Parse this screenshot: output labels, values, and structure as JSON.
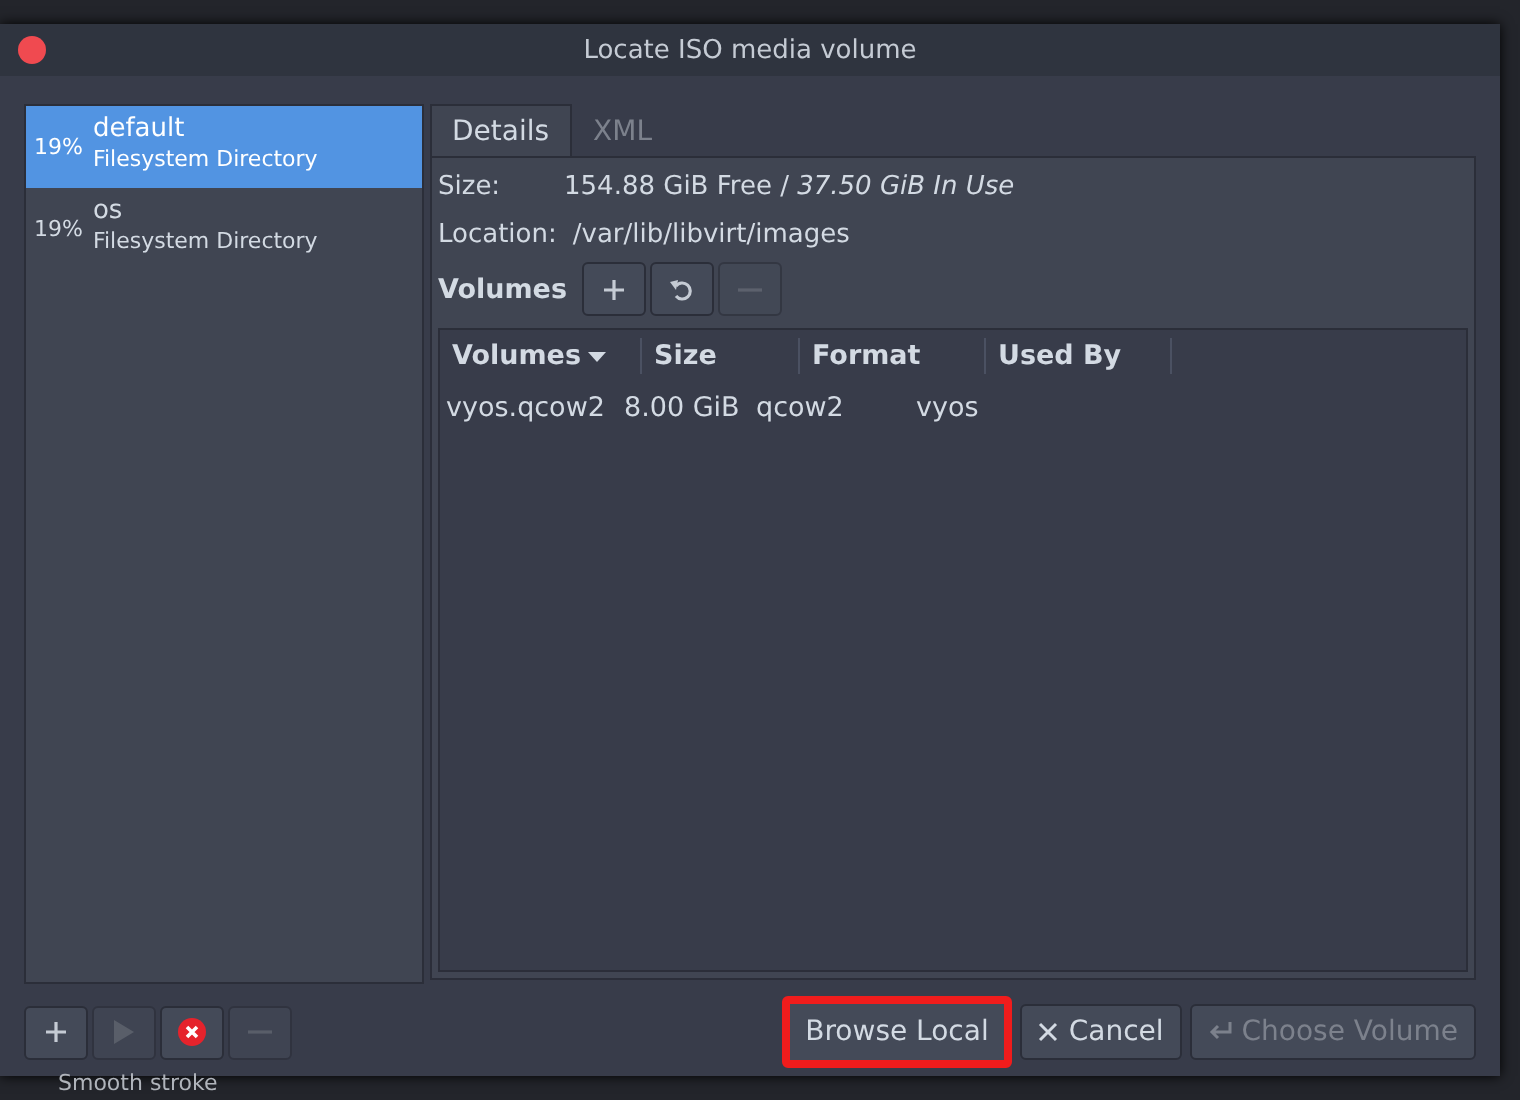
{
  "window": {
    "title": "Locate ISO media volume"
  },
  "pools": [
    {
      "usage": "19%",
      "name": "default",
      "type": "Filesystem Directory",
      "selected": true
    },
    {
      "usage": "19%",
      "name": "os",
      "type": "Filesystem Directory",
      "selected": false
    }
  ],
  "pool_buttons": [
    {
      "kind": "add",
      "disabled": false
    },
    {
      "kind": "start",
      "disabled": true
    },
    {
      "kind": "delete",
      "disabled": false
    },
    {
      "kind": "remove",
      "disabled": true
    }
  ],
  "tabs": [
    {
      "label": "Details",
      "selected": true
    },
    {
      "label": "XML",
      "selected": false
    }
  ],
  "details": {
    "size_label": "Size:",
    "size_value": "154.88 GiB Free / *37.50 GiB In Use*",
    "location_label": "Location:",
    "location_value": "/var/lib/libvirt/images"
  },
  "volumes": {
    "label": "Volumes",
    "buttons": [
      {
        "kind": "add",
        "disabled": false
      },
      {
        "kind": "refresh",
        "disabled": false
      },
      {
        "kind": "remove",
        "disabled": true
      }
    ],
    "columns": [
      {
        "label": "Volumes",
        "sorted": true
      },
      {
        "label": "Size",
        "sorted": false
      },
      {
        "label": "Format",
        "sorted": false
      },
      {
        "label": "Used By",
        "sorted": false
      }
    ],
    "rows": [
      [
        "vyos.qcow2",
        "8.00 GiB",
        "qcow2",
        "vyos"
      ]
    ]
  },
  "actions": [
    {
      "kind": "plain",
      "label": "Browse Local",
      "highlighted": true,
      "disabled": false
    },
    {
      "kind": "cancel",
      "label": "Cancel",
      "highlighted": false,
      "disabled": false
    },
    {
      "kind": "choose",
      "label": "Choose Volume",
      "highlighted": false,
      "disabled": true
    }
  ],
  "background": {
    "text": "Smooth stroke"
  }
}
